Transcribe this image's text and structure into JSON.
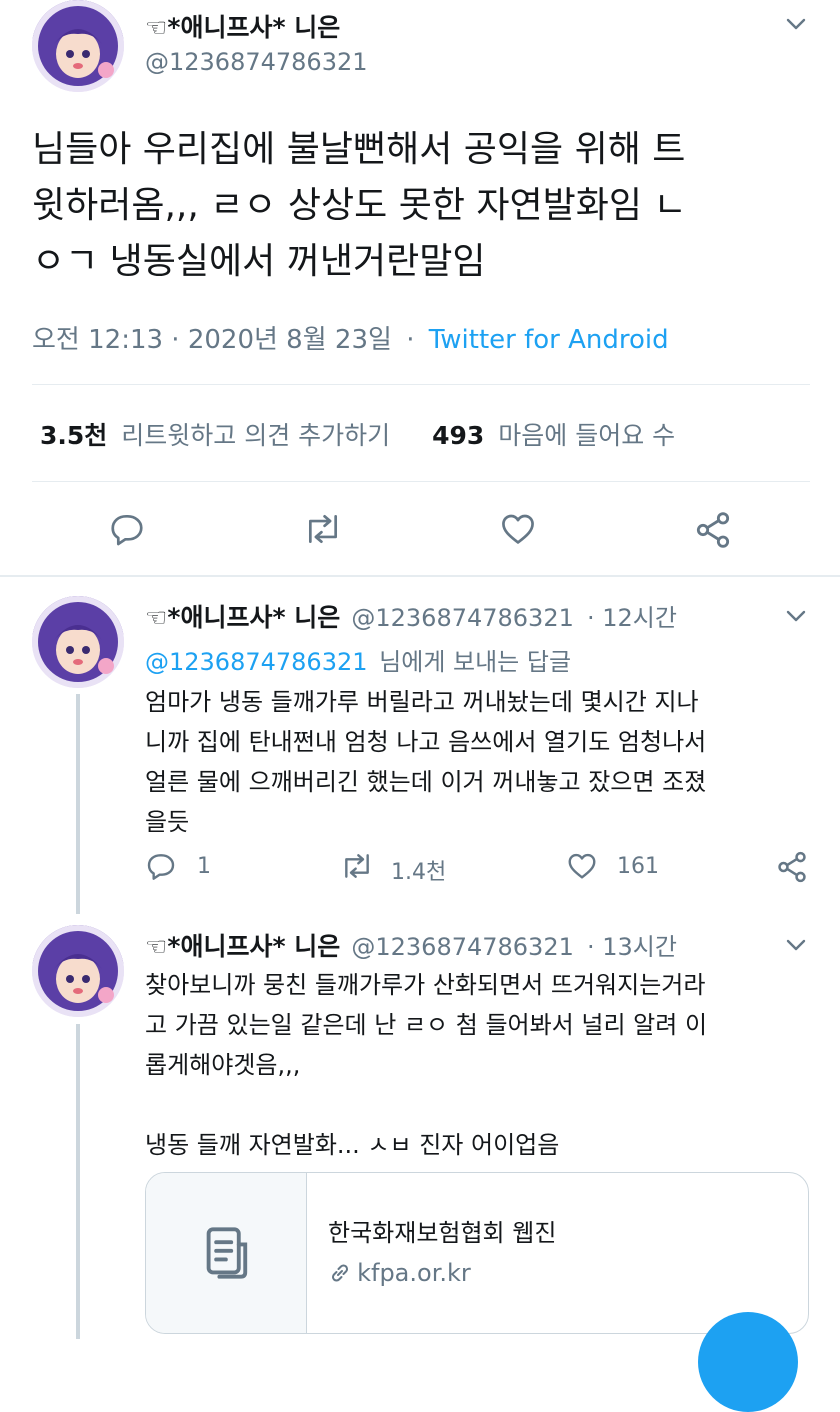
{
  "main_tweet": {
    "display_name": "☜*애니프사* 니은",
    "handle": "@1236874786321",
    "text_lines": [
      "님들아 우리집에 불날뻔해서 공익을 위해 트",
      "윗하러옴,,, ㄹㅇ 상상도 못한 자연발화임 ㄴ",
      "ㅇㄱ 냉동실에서 꺼낸거란말임"
    ],
    "time": "오전 12:13 · 2020년 8월 23일",
    "separator": "·",
    "source": "Twitter for Android",
    "retweets_count": "3.5천",
    "retweets_label": "리트윗하고 의견 추가하기",
    "likes_count": "493",
    "likes_label": "마음에 들어요 수"
  },
  "replies": [
    {
      "display_name": "☜*애니프사* 니은",
      "handle": "@1236874786321",
      "time": "· 12시간",
      "replying_to_handle": "@1236874786321",
      "replying_to_suffix": "님에게 보내는 답글",
      "text_lines": [
        "엄마가 냉동 들깨가루 버릴라고 꺼내놨는데 몇시간 지나",
        "니까 집에 탄내쩐내 엄청 나고 음쓰에서 열기도 엄청나서",
        "얼른 물에 으깨버리긴 했는데 이거 꺼내놓고 잤으면 조졌",
        "을듯"
      ],
      "reply_count": "1",
      "retweet_count": "1.4천",
      "like_count": "161"
    },
    {
      "display_name": "☜*애니프사* 니은",
      "handle": "@1236874786321",
      "time": "· 13시간",
      "text_lines": [
        "찾아보니까 뭉친 들깨가루가 산화되면서 뜨거워지는거라",
        "고 가끔 있는일 같은데 난 ㄹㅇ 첨 들어봐서 널리 알려 이",
        "롭게해야겟음,,,",
        "",
        "냉동 들깨 자연발화... ㅅㅂ 진자 어이업음"
      ],
      "card": {
        "title": "한국화재보험협회 웹진",
        "domain": "kfpa.or.kr"
      }
    }
  ],
  "icons": {
    "reply": "speech-bubble-icon",
    "retweet": "retweet-arrows-icon",
    "like": "heart-icon",
    "share": "share-nodes-icon",
    "more": "chevron-down-icon",
    "link": "link-chain-icon",
    "article": "document-icon"
  },
  "colors": {
    "accent": "#1da1f2",
    "muted": "#657786",
    "text": "#14171a",
    "divider": "#e6ecf0"
  }
}
